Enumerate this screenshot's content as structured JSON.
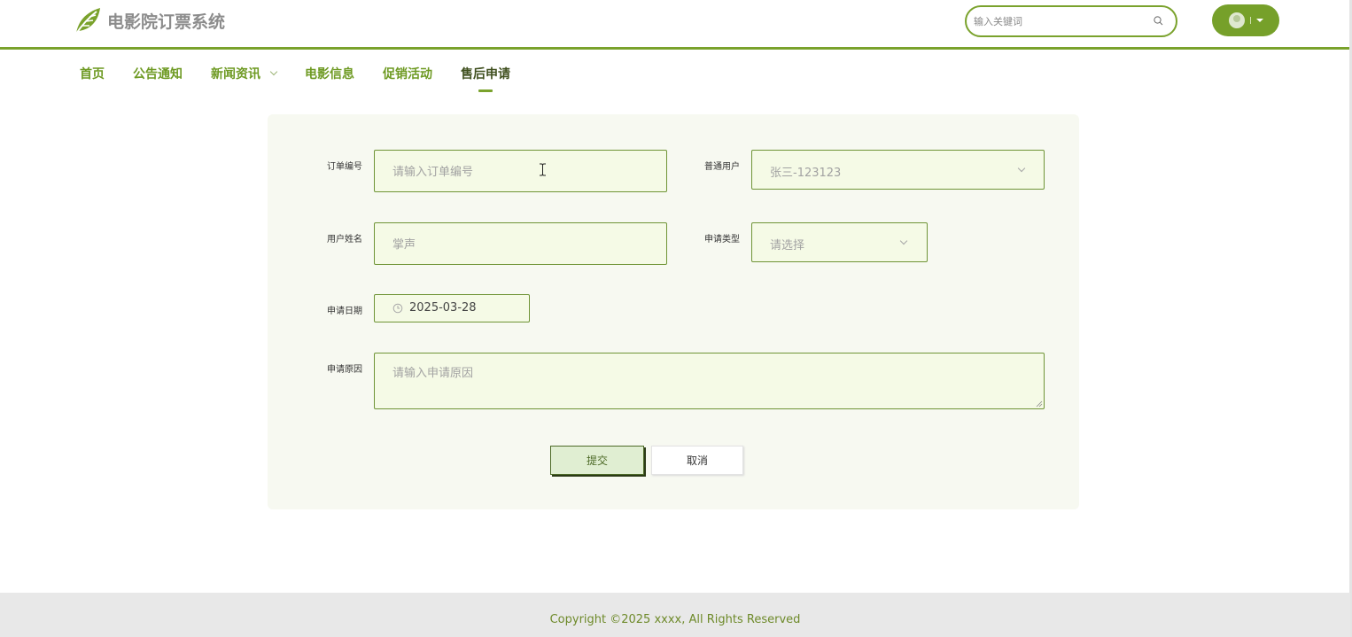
{
  "header": {
    "logo_text": "电影院订票系统",
    "search_placeholder": "输入关键词"
  },
  "nav": {
    "items": [
      {
        "label": "首页",
        "active": false
      },
      {
        "label": "公告通知",
        "active": false
      },
      {
        "label": "新闻资讯",
        "active": false,
        "has_dropdown": true
      },
      {
        "label": "电影信息",
        "active": false
      },
      {
        "label": "促销活动",
        "active": false
      },
      {
        "label": "售后申请",
        "active": true
      }
    ]
  },
  "form": {
    "order_no": {
      "label": "订单编号",
      "placeholder": "请输入订单编号",
      "value": ""
    },
    "user": {
      "label": "普通用户",
      "value": "张三-123123"
    },
    "user_name": {
      "label": "用户姓名",
      "placeholder": "掌声",
      "value": ""
    },
    "apply_type": {
      "label": "申请类型",
      "value": "请选择"
    },
    "apply_date": {
      "label": "申请日期",
      "value": "2025-03-28"
    },
    "apply_reason": {
      "label": "申请原因",
      "placeholder": "请输入申请原因",
      "value": ""
    },
    "submit_label": "提交",
    "cancel_label": "取消"
  },
  "footer": {
    "copyright": "Copyright ©2025 xxxx, All Rights Reserved"
  },
  "colors": {
    "accent": "#7aa22c",
    "field_bg": "#f5fae6",
    "card_bg": "#f7f9f1",
    "footer_bg": "#e8e8e8"
  }
}
